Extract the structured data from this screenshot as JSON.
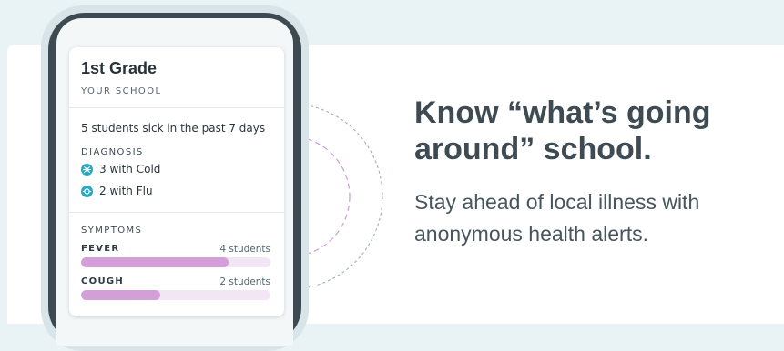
{
  "card": {
    "grade": "1st Grade",
    "school_label": "YOUR SCHOOL",
    "sick_summary": "5 students sick in the past 7 days",
    "diagnosis_label": "DIAGNOSIS",
    "diagnoses": [
      {
        "label": "3 with Cold",
        "icon": "cold-virus-icon",
        "color": "#29a8c4"
      },
      {
        "label": "2 with Flu",
        "icon": "flu-virus-icon",
        "color": "#29a8c4"
      }
    ],
    "symptoms_label": "SYMPTOMS",
    "symptoms": [
      {
        "name": "FEVER",
        "count": "4 students",
        "fill_fraction": 0.78
      },
      {
        "name": "COUGH",
        "count": "2 students",
        "fill_fraction": 0.42
      }
    ]
  },
  "marketing": {
    "headline_line1": "Know “what’s going",
    "headline_line2": "around” school.",
    "subtext": "Stay ahead of local illness with anonymous health alerts."
  },
  "colors": {
    "background": "#e9f2f5",
    "accent_teal": "#29a8c4",
    "bar_fill": "#d39fd8",
    "bar_track": "#f3e6f4",
    "headline": "#3e4b53"
  }
}
